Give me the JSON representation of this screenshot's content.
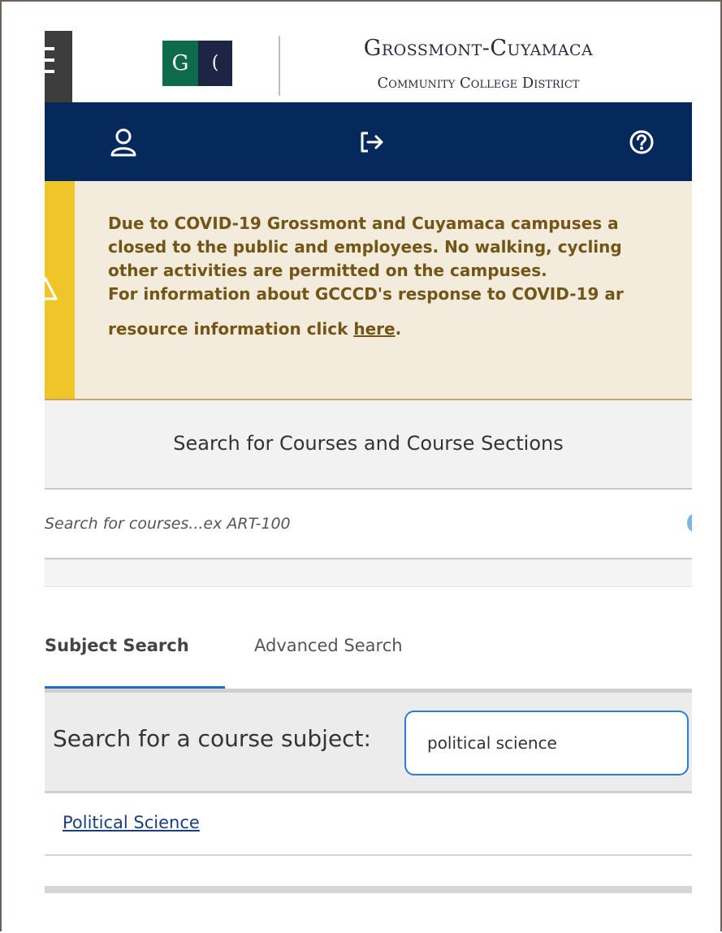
{
  "header": {
    "logo_left_letter": "G",
    "logo_right_symbol": "(",
    "org_name": "Grossmont-Cuyamaca",
    "org_subtitle": "Community College District"
  },
  "navbar": {
    "icons": [
      "user-icon",
      "sign-out-icon",
      "help-icon"
    ],
    "color": "#05295a"
  },
  "alert": {
    "line1": "Due to COVID-19 Grossmont and Cuyamaca campuses a",
    "line2": "closed to the public and employees. No walking, cycling",
    "line3": "other activities are permitted on the campuses.",
    "line4": "For information about GCCCD's response to COVID-19 ar",
    "line5_prefix": "resource information click ",
    "line5_link": "here",
    "line5_suffix": ".",
    "accent": "#f0c52a",
    "background": "#f3ecdc"
  },
  "course_search": {
    "heading": "Search for Courses and Course Sections",
    "placeholder": "Search for courses...ex ART-100"
  },
  "tabs": {
    "subject": "Subject Search",
    "advanced": "Advanced Search",
    "active": "Subject Search"
  },
  "subject_search": {
    "label": "Search for a course subject:",
    "value": "political science"
  },
  "results": [
    {
      "label": "Political Science"
    }
  ]
}
